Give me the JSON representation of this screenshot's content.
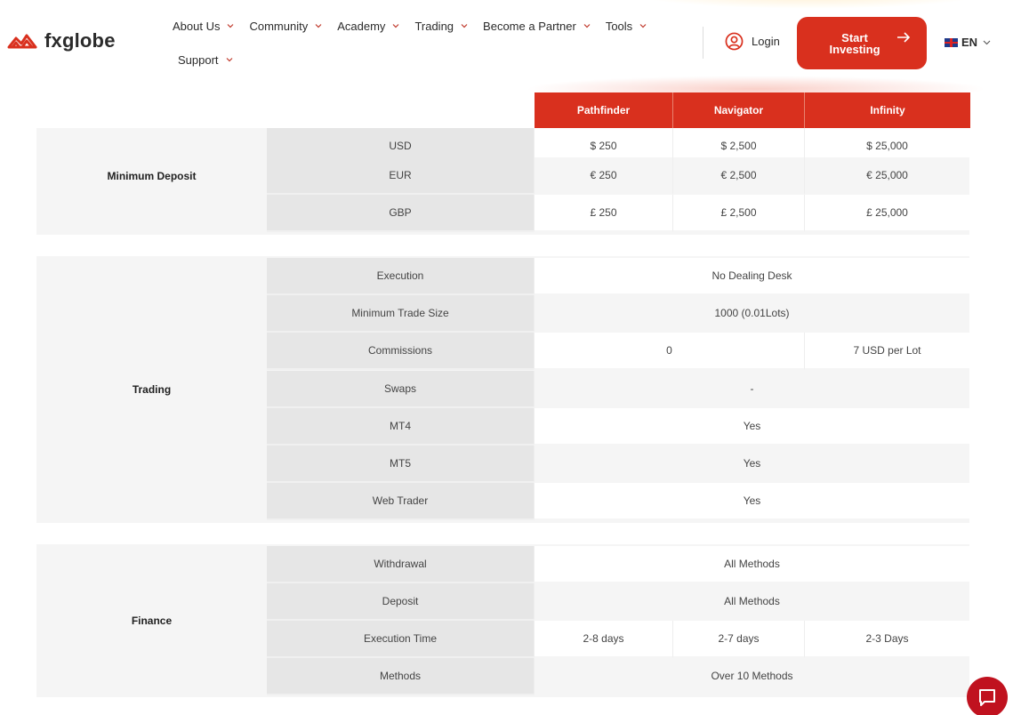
{
  "brand": {
    "name": "fxglobe",
    "accent": "#d9301e",
    "chat_color": "#c0121f"
  },
  "nav": {
    "row1": [
      {
        "label": "About Us"
      },
      {
        "label": "Community"
      },
      {
        "label": "Academy"
      },
      {
        "label": "Trading"
      },
      {
        "label": "Become a Partner"
      },
      {
        "label": "Tools"
      }
    ],
    "row2": [
      {
        "label": "Support"
      }
    ]
  },
  "header_actions": {
    "login_label": "Login",
    "start_line1": "Start",
    "start_line2": "Investing",
    "language": "EN"
  },
  "table": {
    "columns": [
      "Pathfinder",
      "Navigator",
      "Infinity"
    ],
    "minimum_deposit": {
      "category": "Minimum Deposit",
      "rows": [
        {
          "label": "USD",
          "values": [
            "$ 250",
            "$ 2,500",
            "$ 25,000"
          ]
        },
        {
          "label": "EUR",
          "values": [
            "€ 250",
            "€ 2,500",
            "€ 25,000"
          ]
        },
        {
          "label": "GBP",
          "values": [
            "£ 250",
            "£ 2,500",
            "£ 25,000"
          ]
        }
      ]
    },
    "trading": {
      "category": "Trading",
      "rows": [
        {
          "label": "Execution",
          "value": "No Dealing Desk"
        },
        {
          "label": "Minimum Trade Size",
          "value": "1000 (0.01Lots)"
        },
        {
          "label": "Commissions",
          "value_12": "0",
          "value_3": "7 USD per Lot"
        },
        {
          "label": "Swaps",
          "value": "-"
        },
        {
          "label": "MT4",
          "value": "Yes"
        },
        {
          "label": "MT5",
          "value": "Yes"
        },
        {
          "label": "Web Trader",
          "value": "Yes"
        }
      ]
    },
    "finance": {
      "category": "Finance",
      "rows": [
        {
          "label": "Withdrawal",
          "value": "All Methods"
        },
        {
          "label": "Deposit",
          "value": "All Methods"
        },
        {
          "label": "Execution Time",
          "values": [
            "2-8 days",
            "2-7 days",
            "2-3 Days"
          ]
        },
        {
          "label": "Methods",
          "value": "Over 10 Methods"
        }
      ]
    }
  }
}
